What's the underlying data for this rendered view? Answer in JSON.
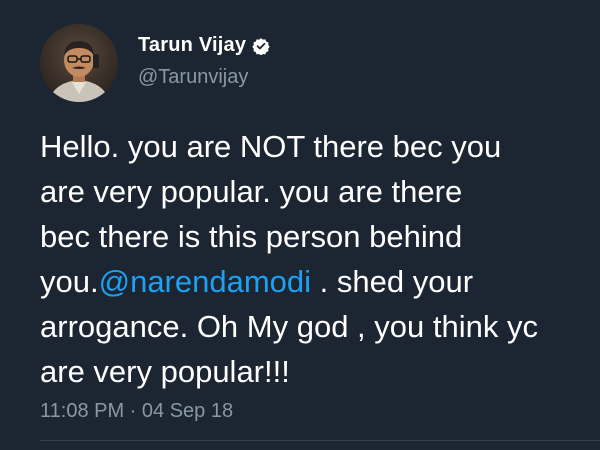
{
  "author": {
    "display_name": "Tarun Vijay",
    "handle": "@Tarunvijay",
    "verified": true,
    "avatar_icon": "profile-photo"
  },
  "tweet": {
    "lines": [
      {
        "text": "Hello. you are NOT there bec you"
      },
      {
        "text": "are very popular. you are there"
      },
      {
        "text": "bec  there is  this person behind"
      },
      {
        "prefix": "you.",
        "mention": "@narendamodi",
        "suffix": " . shed your"
      },
      {
        "text": "arrogance. Oh My god , you think yc"
      },
      {
        "text": "are very popular!!!"
      }
    ],
    "timestamp": "11:08 PM · 04 Sep 18"
  },
  "colors": {
    "background": "#1c2532",
    "text": "#ffffff",
    "secondary": "#8899a6",
    "mention": "#1da1f2"
  }
}
